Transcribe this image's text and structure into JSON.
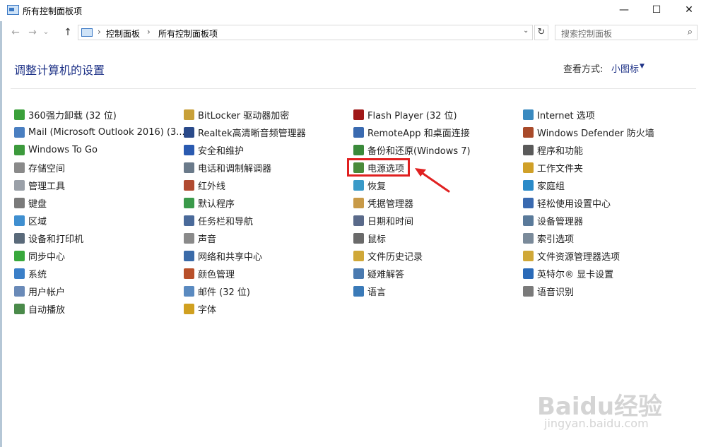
{
  "window": {
    "title": "所有控制面板项",
    "minimize_glyph": "—",
    "maximize_glyph": "☐",
    "close_glyph": "✕"
  },
  "nav": {
    "back_glyph": "←",
    "forward_glyph": "→",
    "recent_glyph": "⌄",
    "up_glyph": "↑",
    "breadcrumb": [
      "控制面板",
      "所有控制面板项"
    ],
    "sep_glyph": "›",
    "dropdown_glyph": "⌄",
    "refresh_glyph": "↻",
    "search_placeholder": "搜索控制面板",
    "search_glyph": "⌕"
  },
  "header": {
    "title": "调整计算机的设置",
    "view_by_label": "查看方式:",
    "view_by_value": "小图标",
    "view_by_arrow": "▼"
  },
  "columns": [
    [
      {
        "label": "360强力卸载 (32 位)",
        "icon": "uninstall-icon",
        "color": "#3aa03a"
      },
      {
        "label": "Mail (Microsoft Outlook 2016) (3...",
        "icon": "mail-icon",
        "color": "#4a7fc1"
      },
      {
        "label": "Windows To Go",
        "icon": "windows-to-go-icon",
        "color": "#3c9a3c"
      },
      {
        "label": "存储空间",
        "icon": "storage-spaces-icon",
        "color": "#8a8a8a"
      },
      {
        "label": "管理工具",
        "icon": "admin-tools-icon",
        "color": "#9aa0a8"
      },
      {
        "label": "键盘",
        "icon": "keyboard-icon",
        "color": "#7a7a7a"
      },
      {
        "label": "区域",
        "icon": "region-icon",
        "color": "#3f8fd0"
      },
      {
        "label": "设备和打印机",
        "icon": "printer-icon",
        "color": "#5a6a7a"
      },
      {
        "label": "同步中心",
        "icon": "sync-center-icon",
        "color": "#38a83c"
      },
      {
        "label": "系统",
        "icon": "system-icon",
        "color": "#3a7fc8"
      },
      {
        "label": "用户帐户",
        "icon": "user-accounts-icon",
        "color": "#6a8ab8"
      },
      {
        "label": "自动播放",
        "icon": "autoplay-icon",
        "color": "#4a8a4a"
      }
    ],
    [
      {
        "label": "BitLocker 驱动器加密",
        "icon": "bitlocker-icon",
        "color": "#c8a038"
      },
      {
        "label": "Realtek高清晰音频管理器",
        "icon": "realtek-audio-icon",
        "color": "#2a4a8a"
      },
      {
        "label": "安全和维护",
        "icon": "security-flag-icon",
        "color": "#2a5ab0"
      },
      {
        "label": "电话和调制解调器",
        "icon": "phone-modem-icon",
        "color": "#6a7a8a"
      },
      {
        "label": "红外线",
        "icon": "infrared-icon",
        "color": "#b04a30"
      },
      {
        "label": "默认程序",
        "icon": "default-programs-icon",
        "color": "#3a9a4a"
      },
      {
        "label": "任务栏和导航",
        "icon": "taskbar-icon",
        "color": "#4a6a9a"
      },
      {
        "label": "声音",
        "icon": "sound-icon",
        "color": "#8a8a8a"
      },
      {
        "label": "网络和共享中心",
        "icon": "network-icon",
        "color": "#3a6aa8"
      },
      {
        "label": "颜色管理",
        "icon": "color-management-icon",
        "color": "#b8502a"
      },
      {
        "label": "邮件 (32 位)",
        "icon": "mail32-icon",
        "color": "#5a8ac0"
      },
      {
        "label": "字体",
        "icon": "fonts-icon",
        "color": "#d0a020"
      }
    ],
    [
      {
        "label": "Flash Player (32 位)",
        "icon": "flash-player-icon",
        "color": "#a01818"
      },
      {
        "label": "RemoteApp 和桌面连接",
        "icon": "remoteapp-icon",
        "color": "#3a6ab0"
      },
      {
        "label": "备份和还原(Windows 7)",
        "icon": "backup-restore-icon",
        "color": "#3a8a3a"
      },
      {
        "label": "电源选项",
        "icon": "power-options-icon",
        "color": "#4a8a3a"
      },
      {
        "label": "恢复",
        "icon": "recovery-icon",
        "color": "#3a9ac8"
      },
      {
        "label": "凭据管理器",
        "icon": "credential-manager-icon",
        "color": "#c89a48"
      },
      {
        "label": "日期和时间",
        "icon": "date-time-icon",
        "color": "#5a6a8a"
      },
      {
        "label": "鼠标",
        "icon": "mouse-icon",
        "color": "#6a6a6a"
      },
      {
        "label": "文件历史记录",
        "icon": "file-history-icon",
        "color": "#d0a838"
      },
      {
        "label": "疑难解答",
        "icon": "troubleshooting-icon",
        "color": "#4a7ab0"
      },
      {
        "label": "语言",
        "icon": "language-icon",
        "color": "#3a7ab8"
      }
    ],
    [
      {
        "label": "Internet 选项",
        "icon": "internet-options-icon",
        "color": "#3a8ac0"
      },
      {
        "label": "Windows Defender 防火墙",
        "icon": "firewall-icon",
        "color": "#a84a2a"
      },
      {
        "label": "程序和功能",
        "icon": "programs-features-icon",
        "color": "#5a5a5a"
      },
      {
        "label": "工作文件夹",
        "icon": "work-folders-icon",
        "color": "#d0a028"
      },
      {
        "label": "家庭组",
        "icon": "homegroup-icon",
        "color": "#2a8ac8"
      },
      {
        "label": "轻松使用设置中心",
        "icon": "ease-of-access-icon",
        "color": "#3a6ab0"
      },
      {
        "label": "设备管理器",
        "icon": "device-manager-icon",
        "color": "#5a7a9a"
      },
      {
        "label": "索引选项",
        "icon": "indexing-icon",
        "color": "#7a8a9a"
      },
      {
        "label": "文件资源管理器选项",
        "icon": "explorer-options-icon",
        "color": "#d0a838"
      },
      {
        "label": "英特尔® 显卡设置",
        "icon": "intel-graphics-icon",
        "color": "#2a6ab8"
      },
      {
        "label": "语音识别",
        "icon": "speech-recognition-icon",
        "color": "#7a7a7a"
      }
    ]
  ],
  "watermark": {
    "main": "Baidu经验",
    "sub": "jingyan.baidu.com"
  }
}
